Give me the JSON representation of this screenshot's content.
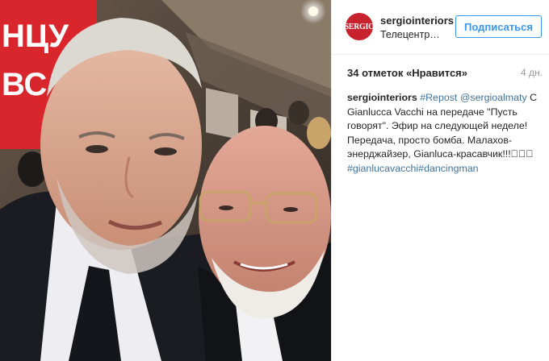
{
  "post": {
    "username": "sergiointeriors",
    "location": "Телецентр…",
    "follow_label": "Подписаться",
    "avatar_text": "SERGIO",
    "likes": "34 отметок «Нравится»",
    "time_ago": "4 дн.",
    "caption": {
      "user": "sergiointeriors",
      "repost_tag": "#Repost",
      "mention": "@sergioalmaty",
      "text": "С Gianlucca Vacchi на передаче \"Пусть говорят\". Эфир на следующей неделе! Передача, просто бомба. Малахов-энерджайзер, Gianluca-красавчик!!!󾌧󾌧󾌧",
      "hashtag_1": "#gianlucavacchi",
      "hashtag_2": "#dancingman"
    }
  },
  "photo": {
    "background_sign_text": "НЦУ ВСЕ"
  },
  "colors": {
    "link": "#3f729b",
    "follow_blue": "#3897f0",
    "avatar_red": "#c8222e",
    "studio_red": "#d9262c"
  }
}
